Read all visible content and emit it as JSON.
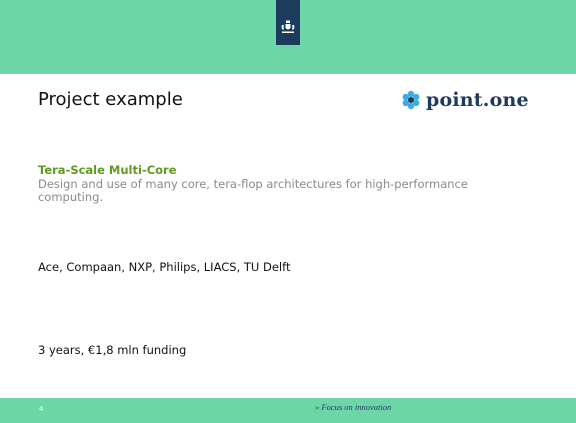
{
  "slide": {
    "title": "Project example",
    "logo_text": "point.one",
    "project": {
      "heading": "Tera-Scale Multi-Core",
      "description": "Design and use of many core, tera-flop architectures for high-performance computing."
    },
    "partners": "Ace, Compaan, NXP, Philips, LIACS, TU Delft",
    "funding": "3 years, €1,8 mln funding",
    "footer": {
      "page_number": "4",
      "tagline": "» Focus on innovation"
    }
  },
  "colors": {
    "band": "#6dd6a8",
    "emblem_tab": "#1c3b5d",
    "heading_green": "#5f9a1f",
    "description_gray": "#8a8a8a",
    "logo_navy": "#1e3a5c",
    "logo_flower": "#3aaee0"
  },
  "icons": {
    "emblem": "royal-coat-of-arms-icon",
    "logo": "point-one-flower-icon"
  }
}
